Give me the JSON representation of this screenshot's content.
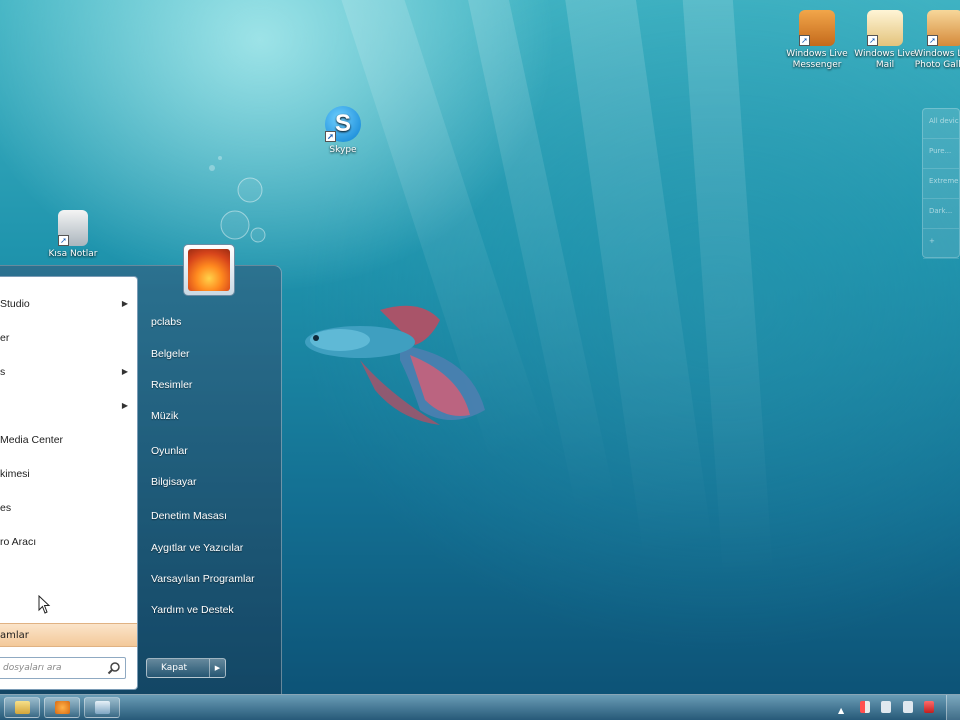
{
  "desktop": {
    "icons": [
      {
        "label": "Windows Live Messenger",
        "icon": "messenger-icon"
      },
      {
        "label": "Windows Live Mail",
        "icon": "mail-icon"
      },
      {
        "label": "Windows Live Photo Gallery",
        "icon": "photo-gallery-icon"
      },
      {
        "label": "Skype",
        "icon": "skype-icon"
      },
      {
        "label": "Kısa Notlar",
        "icon": "notepad-icon"
      }
    ]
  },
  "gadget": {
    "rows": [
      "All devices",
      "Pure...",
      "Extreme...",
      "Dark...",
      "+"
    ]
  },
  "start_menu": {
    "programs": [
      {
        "label": "Studio",
        "has_submenu": true
      },
      {
        "label": "er",
        "has_submenu": false
      },
      {
        "label": "s",
        "has_submenu": true
      },
      {
        "label": "",
        "has_submenu": true
      },
      {
        "label": "Media Center",
        "has_submenu": false
      },
      {
        "label": "kimesi",
        "has_submenu": false
      },
      {
        "label": "es",
        "has_submenu": false
      },
      {
        "label": "ro Aracı",
        "has_submenu": false
      }
    ],
    "all_programs_label": "amlar",
    "search_placeholder": "dosyaları ara",
    "right_items": [
      "pclabs",
      "Belgeler",
      "Resimler",
      "Müzik",
      "Oyunlar",
      "Bilgisayar",
      "Denetim Masası",
      "Aygıtlar ve Yazıcılar",
      "Varsayılan Programlar",
      "Yardım ve Destek"
    ],
    "shutdown_label": "Kapat"
  },
  "taskbar": {
    "pinned": [
      "explorer-icon",
      "media-player-icon",
      "window-icon"
    ]
  },
  "colors": {
    "accent": "#1f94ad",
    "all_programs_highlight": "#f3c99a"
  }
}
